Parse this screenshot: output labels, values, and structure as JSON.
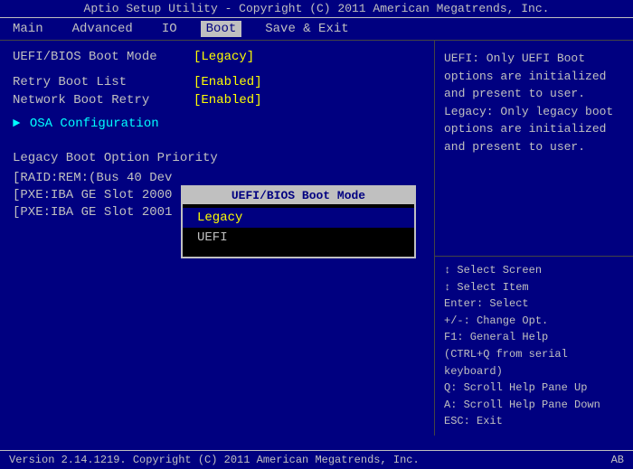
{
  "title_bar": {
    "text": "Aptio Setup Utility - Copyright (C) 2011 American Megatrends, Inc."
  },
  "menu": {
    "items": [
      {
        "label": "Main",
        "active": false
      },
      {
        "label": "Advanced",
        "active": false
      },
      {
        "label": "IO",
        "active": false
      },
      {
        "label": "Boot",
        "active": true
      },
      {
        "label": "Save & Exit",
        "active": false
      }
    ]
  },
  "left_panel": {
    "settings": [
      {
        "label": "UEFI/BIOS Boot Mode",
        "value": "[Legacy]"
      },
      {
        "label": "",
        "value": ""
      },
      {
        "label": "Retry Boot List",
        "value": "[Enabled]"
      },
      {
        "label": "Network Boot Retry",
        "value": "[Enabled]"
      }
    ],
    "arrow_item": "OSA Configuration",
    "section_title": "Legacy Boot Option Priority",
    "boot_options": [
      "[RAID:REM:(Bus 40 Dev",
      "[PXE:IBA GE Slot 2000",
      "[PXE:IBA GE Slot 2001"
    ]
  },
  "right_top": {
    "text": "UEFI: Only UEFI Boot options are initialized and present to user. Legacy: Only legacy boot options are initialized and present to user."
  },
  "right_bottom": {
    "lines": [
      "Select Screen",
      "Select Item",
      "Enter: Select",
      "+/-: Change Opt.",
      "F1: General Help",
      "(CTRL+Q from serial",
      "keyboard)",
      "Q: Scroll Help Pane Up",
      "A: Scroll Help Pane Down",
      "ESC: Exit"
    ]
  },
  "popup": {
    "title": "UEFI/BIOS Boot Mode",
    "options": [
      {
        "label": "Legacy",
        "selected": true
      },
      {
        "label": "UEFI",
        "selected": false
      }
    ]
  },
  "status_bar": {
    "text": "Version 2.14.1219. Copyright (C) 2011 American Megatrends, Inc.",
    "badge": "AB"
  }
}
